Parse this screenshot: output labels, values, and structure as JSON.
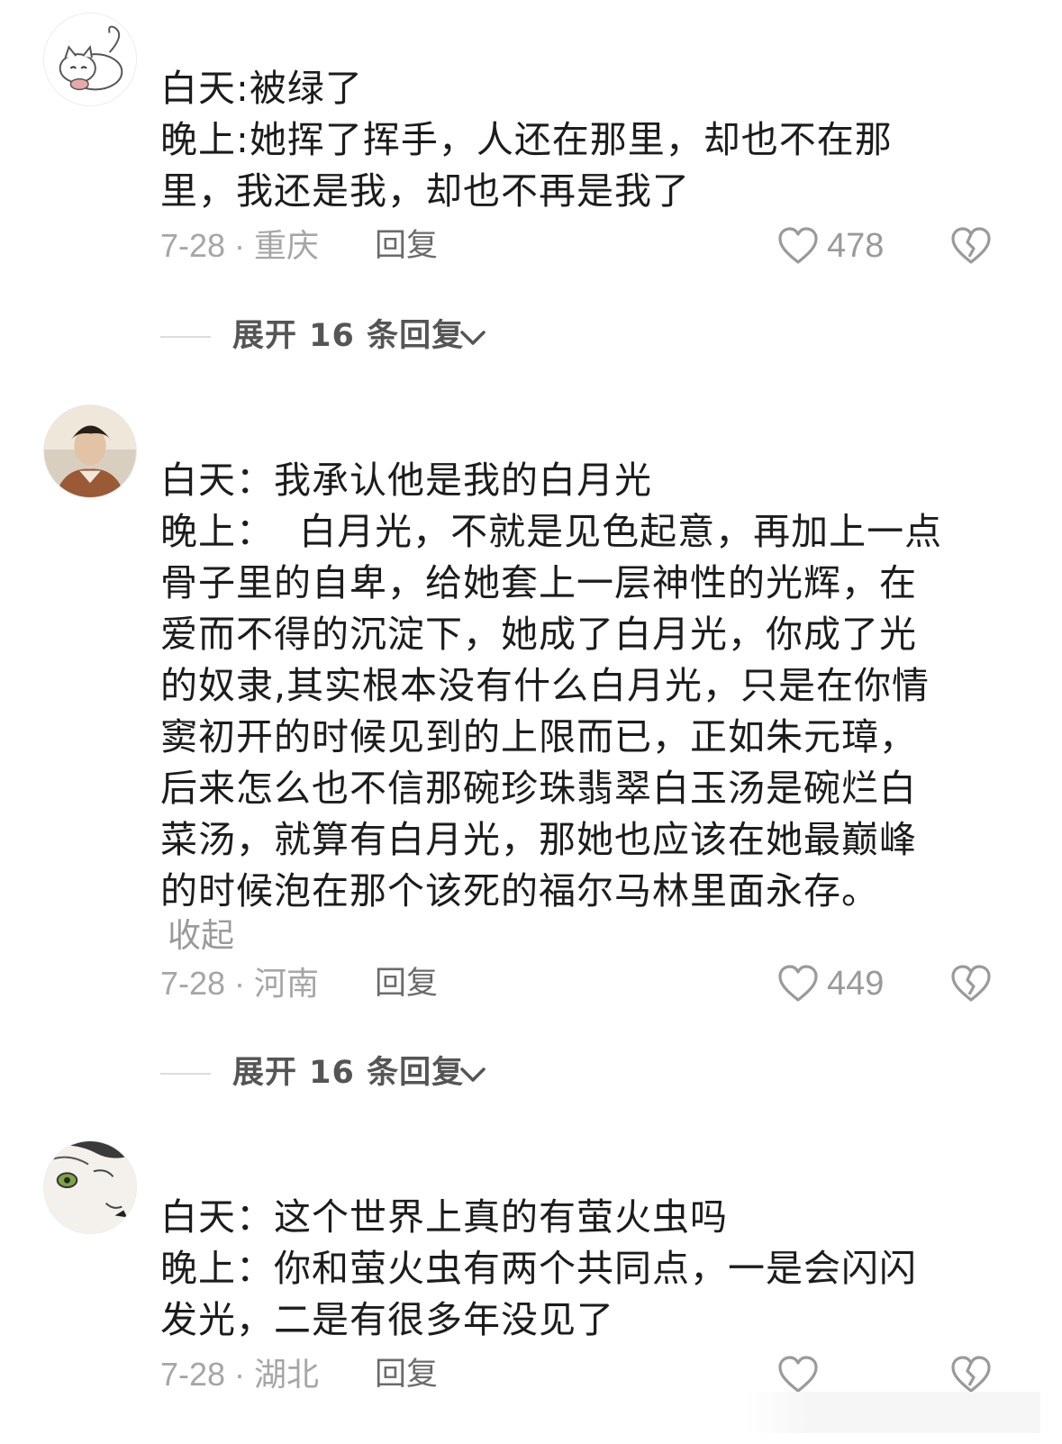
{
  "comments": [
    {
      "lines": [
        "白天:被绿了",
        "晚上:她挥了挥手，人还在那里，却也不在那",
        "里，我还是我，却也不再是我了"
      ],
      "date_location": "7-28 · 重庆",
      "reply_label": "回复",
      "likes": "478",
      "expand_label": "展开 16 条回复"
    },
    {
      "lines": [
        "白天：我承认他是我的白月光",
        "晚上：  白月光，不就是见色起意，再加上一点",
        "骨子里的自卑，给她套上一层神性的光辉，在",
        "爱而不得的沉淀下，她成了白月光，你成了光",
        "的奴隶,其实根本没有什么白月光，只是在你情",
        "窦初开的时候见到的上限而已，正如朱元璋，",
        "后来怎么也不信那碗珍珠翡翠白玉汤是碗烂白",
        "菜汤，就算有白月光，那她也应该在她最巅峰",
        "的时候泡在那个该死的福尔马林里面永存。"
      ],
      "collapse_label": "收起",
      "date_location": "7-28 · 河南",
      "reply_label": "回复",
      "likes": "449",
      "expand_label": "展开 16 条回复"
    },
    {
      "lines": [
        "白天：这个世界上真的有萤火虫吗",
        "晚上：你和萤火虫有两个共同点，一是会闪闪",
        "发光，二是有很多年没见了"
      ],
      "date_location": "7-28 · 湖北",
      "reply_label": "回复"
    }
  ],
  "icons": {
    "like": "heart-outline-icon",
    "dislike": "broken-heart-icon",
    "expand": "chevron-down-icon"
  },
  "colors": {
    "text": "#1c1c1c",
    "meta": "#a6a6a6",
    "reply": "#6b6b6b",
    "expand": "#555555"
  }
}
